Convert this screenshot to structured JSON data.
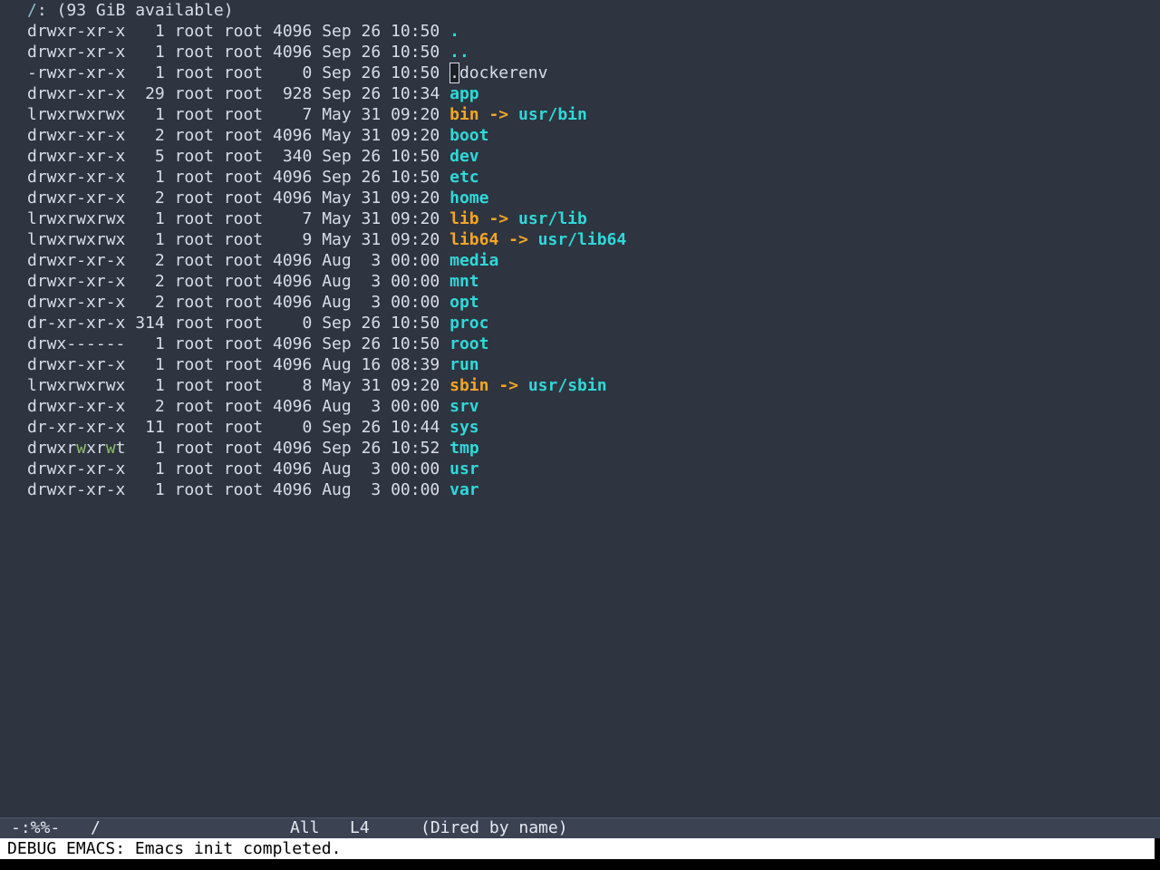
{
  "header": {
    "path": "/",
    "rest": ": (93 GiB available)"
  },
  "entries": [
    {
      "perm": "drwxr-xr-x",
      "links": "1",
      "owner": "root",
      "group": "root",
      "size": "4096",
      "mon": "Sep",
      "day": "26",
      "time": "10:50",
      "name": ".",
      "kind": "dotdir"
    },
    {
      "perm": "drwxr-xr-x",
      "links": "1",
      "owner": "root",
      "group": "root",
      "size": "4096",
      "mon": "Sep",
      "day": "26",
      "time": "10:50",
      "name": "..",
      "kind": "dotdir"
    },
    {
      "perm": "-rwxr-xr-x",
      "links": "1",
      "owner": "root",
      "group": "root",
      "size": "0",
      "mon": "Sep",
      "day": "26",
      "time": "10:50",
      "name": ".dockerenv",
      "kind": "file",
      "cursor": true
    },
    {
      "perm": "drwxr-xr-x",
      "links": "29",
      "owner": "root",
      "group": "root",
      "size": "928",
      "mon": "Sep",
      "day": "26",
      "time": "10:34",
      "name": "app",
      "kind": "dir"
    },
    {
      "perm": "lrwxrwxrwx",
      "links": "1",
      "owner": "root",
      "group": "root",
      "size": "7",
      "mon": "May",
      "day": "31",
      "time": "09:20",
      "name": "bin",
      "kind": "link",
      "target": "usr/bin"
    },
    {
      "perm": "drwxr-xr-x",
      "links": "2",
      "owner": "root",
      "group": "root",
      "size": "4096",
      "mon": "May",
      "day": "31",
      "time": "09:20",
      "name": "boot",
      "kind": "dir"
    },
    {
      "perm": "drwxr-xr-x",
      "links": "5",
      "owner": "root",
      "group": "root",
      "size": "340",
      "mon": "Sep",
      "day": "26",
      "time": "10:50",
      "name": "dev",
      "kind": "dir"
    },
    {
      "perm": "drwxr-xr-x",
      "links": "1",
      "owner": "root",
      "group": "root",
      "size": "4096",
      "mon": "Sep",
      "day": "26",
      "time": "10:50",
      "name": "etc",
      "kind": "dir"
    },
    {
      "perm": "drwxr-xr-x",
      "links": "2",
      "owner": "root",
      "group": "root",
      "size": "4096",
      "mon": "May",
      "day": "31",
      "time": "09:20",
      "name": "home",
      "kind": "dir"
    },
    {
      "perm": "lrwxrwxrwx",
      "links": "1",
      "owner": "root",
      "group": "root",
      "size": "7",
      "mon": "May",
      "day": "31",
      "time": "09:20",
      "name": "lib",
      "kind": "link",
      "target": "usr/lib"
    },
    {
      "perm": "lrwxrwxrwx",
      "links": "1",
      "owner": "root",
      "group": "root",
      "size": "9",
      "mon": "May",
      "day": "31",
      "time": "09:20",
      "name": "lib64",
      "kind": "link",
      "target": "usr/lib64"
    },
    {
      "perm": "drwxr-xr-x",
      "links": "2",
      "owner": "root",
      "group": "root",
      "size": "4096",
      "mon": "Aug",
      "day": "3",
      "time": "00:00",
      "name": "media",
      "kind": "dir"
    },
    {
      "perm": "drwxr-xr-x",
      "links": "2",
      "owner": "root",
      "group": "root",
      "size": "4096",
      "mon": "Aug",
      "day": "3",
      "time": "00:00",
      "name": "mnt",
      "kind": "dir"
    },
    {
      "perm": "drwxr-xr-x",
      "links": "2",
      "owner": "root",
      "group": "root",
      "size": "4096",
      "mon": "Aug",
      "day": "3",
      "time": "00:00",
      "name": "opt",
      "kind": "dir"
    },
    {
      "perm": "dr-xr-xr-x",
      "links": "314",
      "owner": "root",
      "group": "root",
      "size": "0",
      "mon": "Sep",
      "day": "26",
      "time": "10:50",
      "name": "proc",
      "kind": "dir"
    },
    {
      "perm": "drwx------",
      "links": "1",
      "owner": "root",
      "group": "root",
      "size": "4096",
      "mon": "Sep",
      "day": "26",
      "time": "10:50",
      "name": "root",
      "kind": "dir"
    },
    {
      "perm": "drwxr-xr-x",
      "links": "1",
      "owner": "root",
      "group": "root",
      "size": "4096",
      "mon": "Aug",
      "day": "16",
      "time": "08:39",
      "name": "run",
      "kind": "dir"
    },
    {
      "perm": "lrwxrwxrwx",
      "links": "1",
      "owner": "root",
      "group": "root",
      "size": "8",
      "mon": "May",
      "day": "31",
      "time": "09:20",
      "name": "sbin",
      "kind": "link",
      "target": "usr/sbin"
    },
    {
      "perm": "drwxr-xr-x",
      "links": "2",
      "owner": "root",
      "group": "root",
      "size": "4096",
      "mon": "Aug",
      "day": "3",
      "time": "00:00",
      "name": "srv",
      "kind": "dir"
    },
    {
      "perm": "dr-xr-xr-x",
      "links": "11",
      "owner": "root",
      "group": "root",
      "size": "0",
      "mon": "Sep",
      "day": "26",
      "time": "10:44",
      "name": "sys",
      "kind": "dir"
    },
    {
      "perm": "drwxrwxrwt",
      "links": "1",
      "owner": "root",
      "group": "root",
      "size": "4096",
      "mon": "Sep",
      "day": "26",
      "time": "10:52",
      "name": "tmp",
      "kind": "dir",
      "perm_highlight": [
        5,
        8
      ]
    },
    {
      "perm": "drwxr-xr-x",
      "links": "1",
      "owner": "root",
      "group": "root",
      "size": "4096",
      "mon": "Aug",
      "day": "3",
      "time": "00:00",
      "name": "usr",
      "kind": "dir"
    },
    {
      "perm": "drwxr-xr-x",
      "links": "1",
      "owner": "root",
      "group": "root",
      "size": "4096",
      "mon": "Aug",
      "day": "3",
      "time": "00:00",
      "name": "var",
      "kind": "dir"
    }
  ],
  "link_arrow": "->",
  "modeline": {
    "status": "-:%%-",
    "buffer": "/",
    "position": "All",
    "line": "L4",
    "mode": "(Dired by name)"
  },
  "minibuffer": {
    "message": "DEBUG EMACS: Emacs init completed."
  },
  "colors": {
    "background": "#2e3440",
    "directory": "#2fd9d9",
    "symlink": "#f5a623",
    "text": "#d8dee9"
  }
}
